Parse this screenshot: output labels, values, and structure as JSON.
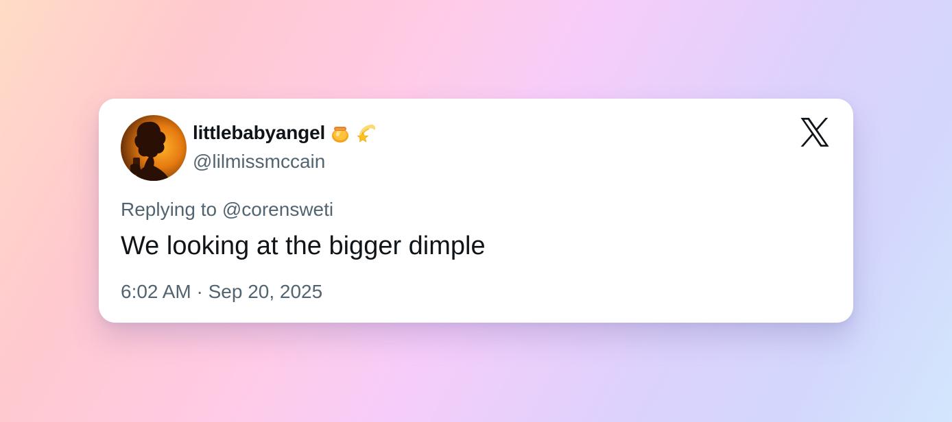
{
  "tweet": {
    "display_name": "littlebabyangel",
    "emojis": [
      "honey-pot-emoji",
      "dizzy-star-emoji"
    ],
    "handle": "@lilmissmccain",
    "replying_to": "Replying to @corensweti",
    "text": "We looking at the bigger dimple",
    "timestamp": "6:02 AM · Sep 20, 2025"
  },
  "brand": {
    "logo": "x-logo-icon",
    "color": "#0f1419"
  },
  "colors": {
    "primary_text": "#0f1419",
    "secondary_text": "#536471",
    "card_background": "#ffffff"
  }
}
